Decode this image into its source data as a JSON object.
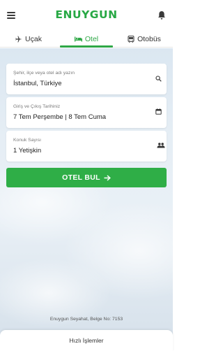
{
  "header": {
    "logo": "ENUYGUN",
    "brand_color": "#27a844"
  },
  "tabs": [
    {
      "label": "Uçak",
      "icon": "airplane-icon"
    },
    {
      "label": "Otel",
      "icon": "bed-icon",
      "active": true
    },
    {
      "label": "Otobüs",
      "icon": "bus-icon"
    }
  ],
  "form": {
    "destination": {
      "label": "Şehir, ilçe veya otel adı yazın",
      "value": "İstanbul, Türkiye",
      "icon": "search-icon"
    },
    "dates": {
      "label": "Giriş ve Çıkış Tarihiniz",
      "value": "7 Tem Perşembe | 8 Tem Cuma",
      "icon": "calendar-icon"
    },
    "guests": {
      "label": "Konuk Sayısı",
      "value": "1 Yetişkin",
      "icon": "people-icon"
    },
    "submit_label": "OTEL BUL",
    "submit_icon": "arrow-right-icon",
    "accent_color": "#2fae47"
  },
  "footer": {
    "license": "Enuygun Seyahat, Belge No: 7153",
    "quick_actions": "Hızlı İşlemler"
  }
}
